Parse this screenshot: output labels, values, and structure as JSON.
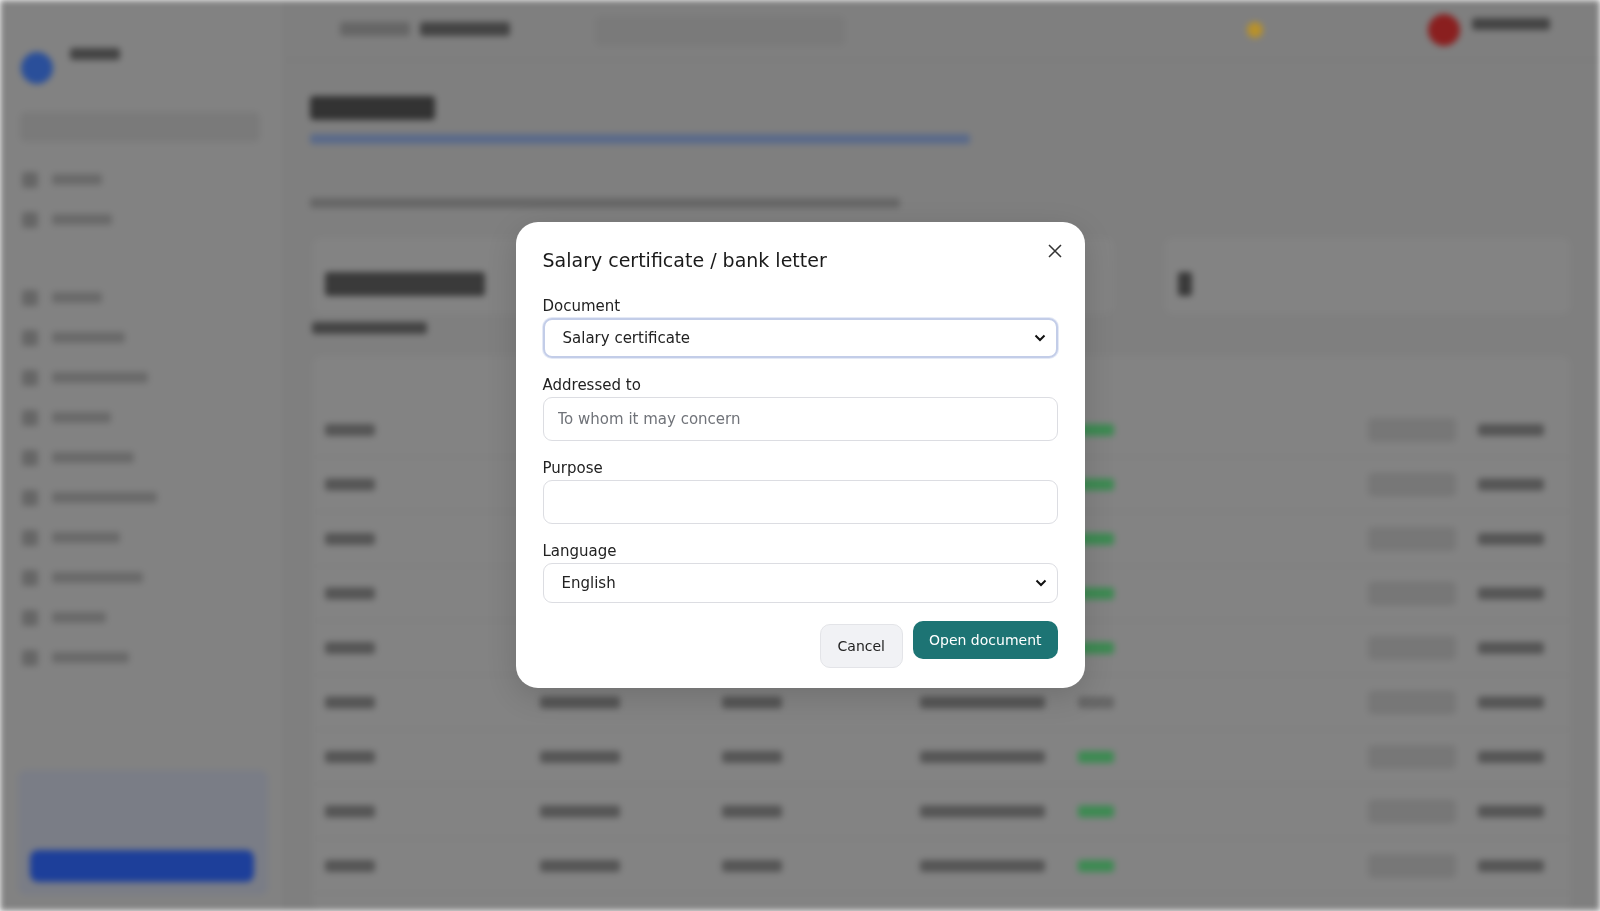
{
  "dialog": {
    "title": "Salary certificate / bank letter",
    "fields": [
      {
        "kind": "select",
        "label": "Document",
        "value": "Salary certificate",
        "focused": true
      },
      {
        "kind": "text",
        "label": "Addressed to",
        "placeholder": "To whom it may concern",
        "focused": false
      },
      {
        "kind": "text",
        "label": "Purpose",
        "focused": false
      },
      {
        "kind": "select",
        "label": "Language",
        "value": "English",
        "focused": false
      }
    ],
    "buttons": [
      {
        "kind": "secondary",
        "label": "Cancel"
      },
      {
        "kind": "primary",
        "label": "Open document"
      }
    ]
  }
}
